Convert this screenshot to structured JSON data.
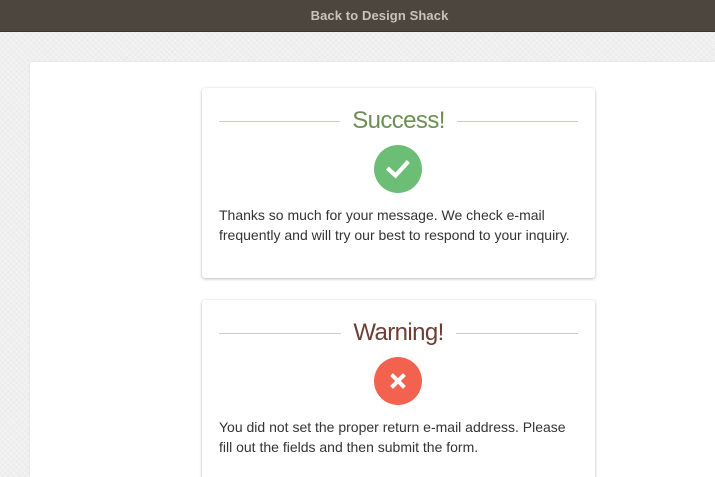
{
  "topbar": {
    "back_link": "Back to Design Shack"
  },
  "cards": {
    "success": {
      "title": "Success!",
      "icon": "checkmark-icon",
      "message": "Thanks so much for your message. We check e-mail frequently and will try our best to respond to your inquiry.",
      "color": "#6cbe76"
    },
    "warning": {
      "title": "Warning!",
      "icon": "x-icon",
      "message": "You did not set the proper return e-mail address. Please fill out the fields and then submit the form.",
      "color": "#f2624f"
    }
  }
}
